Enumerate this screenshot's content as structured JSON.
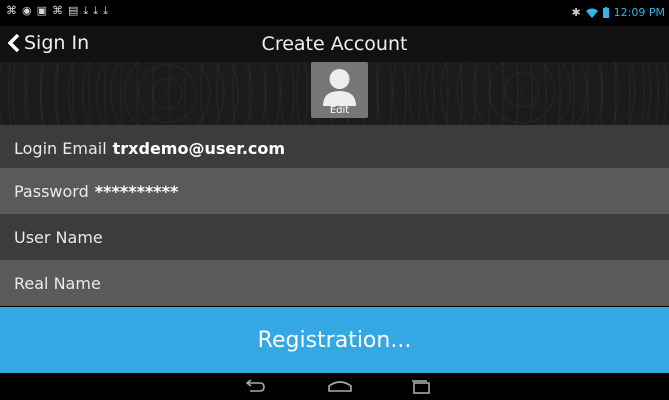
{
  "status_bar": {
    "notification_icons": [
      "usb-icon",
      "location-icon",
      "image-icon",
      "usb-icon",
      "sd-card-icon",
      "download-icon",
      "download-icon",
      "download-icon"
    ],
    "time": "12:09 PM"
  },
  "action_bar": {
    "back_label": "Sign In",
    "title": "Create Account"
  },
  "avatar": {
    "edit_label": "Edit"
  },
  "fields": {
    "login_email_label": "Login Email",
    "login_email_value": "trxdemo@user.com",
    "password_label": "Password",
    "password_value": "**********",
    "user_name_label": "User Name",
    "real_name_label": "Real Name"
  },
  "registration_button": "Registration...",
  "colors": {
    "accent": "#33a8e5",
    "row_dark": "#3c3c3c",
    "row_light": "#5a5a5a"
  }
}
